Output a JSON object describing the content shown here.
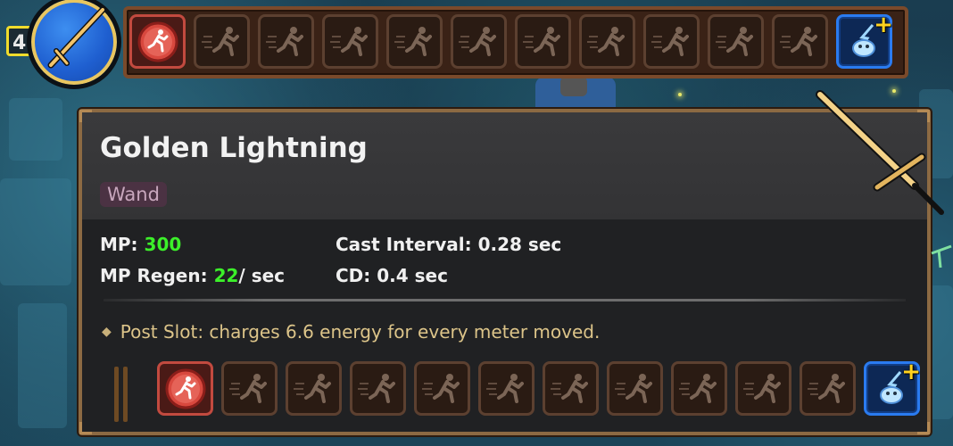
{
  "hud": {
    "level_badge": "4",
    "equipped_weapon_icon": "golden-wand-icon",
    "top_slots": [
      {
        "kind": "red",
        "icon": "red-run-orb-icon"
      },
      {
        "kind": "empty",
        "icon": "dash-runner-icon"
      },
      {
        "kind": "empty",
        "icon": "dash-runner-icon"
      },
      {
        "kind": "empty",
        "icon": "dash-runner-icon"
      },
      {
        "kind": "empty",
        "icon": "dash-runner-icon"
      },
      {
        "kind": "empty",
        "icon": "dash-runner-icon"
      },
      {
        "kind": "empty",
        "icon": "dash-runner-icon"
      },
      {
        "kind": "empty",
        "icon": "dash-runner-icon"
      },
      {
        "kind": "empty",
        "icon": "dash-runner-icon"
      },
      {
        "kind": "empty",
        "icon": "dash-runner-icon"
      },
      {
        "kind": "empty",
        "icon": "dash-runner-icon"
      },
      {
        "kind": "blue",
        "icon": "lightning-spirit-add-icon"
      }
    ]
  },
  "tooltip": {
    "title": "Golden Lightning",
    "type_tag": "Wand",
    "mp_label": "MP: ",
    "mp_value": "300",
    "mp_regen_label": "MP Regen: ",
    "mp_regen_value": "22",
    "mp_regen_unit": "/ sec",
    "cast_interval": "Cast Interval: 0.28 sec",
    "cd": "CD: 0.4 sec",
    "effect": "Post Slot: charges 6.6 energy for every meter moved.",
    "bottom_slots": [
      {
        "kind": "red",
        "icon": "red-run-orb-icon"
      },
      {
        "kind": "empty",
        "icon": "dash-runner-icon"
      },
      {
        "kind": "empty",
        "icon": "dash-runner-icon"
      },
      {
        "kind": "empty",
        "icon": "dash-runner-icon"
      },
      {
        "kind": "empty",
        "icon": "dash-runner-icon"
      },
      {
        "kind": "empty",
        "icon": "dash-runner-icon"
      },
      {
        "kind": "empty",
        "icon": "dash-runner-icon"
      },
      {
        "kind": "empty",
        "icon": "dash-runner-icon"
      },
      {
        "kind": "empty",
        "icon": "dash-runner-icon"
      },
      {
        "kind": "empty",
        "icon": "dash-runner-icon"
      },
      {
        "kind": "empty",
        "icon": "dash-runner-icon"
      },
      {
        "kind": "blue",
        "icon": "lightning-spirit-add-icon"
      }
    ]
  },
  "colors": {
    "value_green": "#3cf02a",
    "effect_text": "#dcc489",
    "panel_border": "#8c6a43",
    "slot_bar": "#3a2216"
  }
}
